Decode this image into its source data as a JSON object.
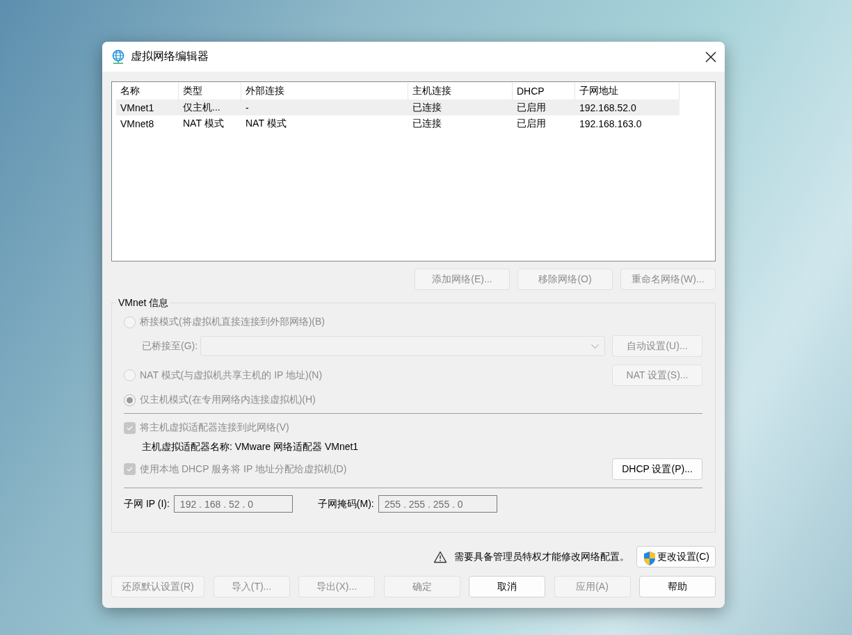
{
  "window": {
    "title": "虚拟网络编辑器"
  },
  "table": {
    "columns": [
      "名称",
      "类型",
      "外部连接",
      "主机连接",
      "DHCP",
      "子网地址"
    ],
    "rows": [
      {
        "cells": [
          "VMnet1",
          "仅主机...",
          "-",
          "已连接",
          "已启用",
          "192.168.52.0"
        ],
        "selected": true
      },
      {
        "cells": [
          "VMnet8",
          "NAT 模式",
          "NAT 模式",
          "已连接",
          "已启用",
          "192.168.163.0"
        ],
        "selected": false
      }
    ]
  },
  "network_buttons": [
    {
      "label": "添加网络(E)...",
      "disabled": true
    },
    {
      "label": "移除网络(O)",
      "disabled": true
    },
    {
      "label": "重命名网络(W)...",
      "disabled": true
    }
  ],
  "vmnet_info": {
    "title": "VMnet 信息",
    "bridged_radio": {
      "label": "桥接模式(将虚拟机直接连接到外部网络)(B)",
      "selected": false,
      "disabled": true
    },
    "bridged_to": {
      "label": "已桥接至(G):",
      "disabled": true
    },
    "auto_button": {
      "label": "自动设置(U)...",
      "disabled": true
    },
    "nat_radio": {
      "label": "NAT 模式(与虚拟机共享主机的 IP 地址)(N)",
      "selected": false,
      "disabled": true
    },
    "nat_button": {
      "label": "NAT 设置(S)...",
      "disabled": true
    },
    "host_only_radio": {
      "label": "仅主机模式(在专用网络内连接虚拟机)(H)",
      "selected": true,
      "disabled": true
    },
    "connect_adapter": {
      "label": "将主机虚拟适配器连接到此网络(V)",
      "checked": true,
      "disabled": true
    },
    "adapter_name": "主机虚拟适配器名称: VMware 网络适配器 VMnet1",
    "dhcp_checkbox": {
      "label": "使用本地 DHCP 服务将 IP 地址分配给虚拟机(D)",
      "checked": true,
      "disabled": true
    },
    "dhcp_button": {
      "label": "DHCP 设置(P)...",
      "disabled": false
    },
    "subnet_ip": {
      "label": "子网 IP (I):",
      "value": "192 . 168 . 52 . 0"
    },
    "subnet_mask": {
      "label": "子网掩码(M):",
      "value": "255 . 255 . 255 . 0"
    }
  },
  "admin_notice": "需要具备管理员特权才能修改网络配置。",
  "change_settings_button": {
    "label": "更改设置(C)",
    "disabled": false
  },
  "footer_buttons": [
    {
      "label": "还原默认设置(R)",
      "disabled": true
    },
    {
      "label": "导入(T)...",
      "disabled": true
    },
    {
      "label": "导出(X)...",
      "disabled": true
    },
    {
      "label": "确定",
      "disabled": true
    },
    {
      "label": "取消",
      "disabled": false
    },
    {
      "label": "应用(A)",
      "disabled": true
    },
    {
      "label": "帮助",
      "disabled": false
    }
  ]
}
